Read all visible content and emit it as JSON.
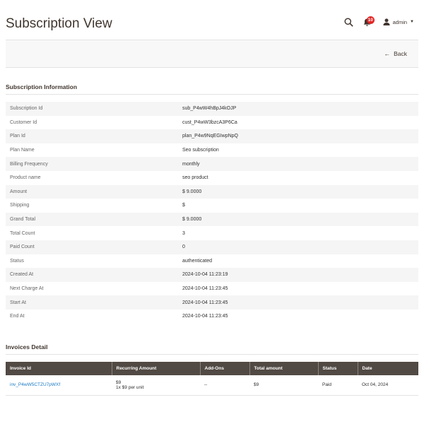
{
  "header": {
    "title": "Subscription View",
    "notification_count": "10",
    "user_name": "admin"
  },
  "actions": {
    "back_label": "Back"
  },
  "subscription_info": {
    "heading": "Subscription Information",
    "rows": [
      {
        "label": "Subscription Id",
        "value": "sub_P4wW4hBpJ4kOJP"
      },
      {
        "label": "Customer Id",
        "value": "cust_P4wW3bzcA3P6Ca"
      },
      {
        "label": "Plan Id",
        "value": "plan_P4w9NqEGIwpNpQ"
      },
      {
        "label": "Plan Name",
        "value": "Seo subscription"
      },
      {
        "label": "Billing Frequency",
        "value": "monthly"
      },
      {
        "label": "Product name",
        "value": "seo product"
      },
      {
        "label": "Amount",
        "value": "$ 9.0000"
      },
      {
        "label": "Shipping",
        "value": "$"
      },
      {
        "label": "Grand Total",
        "value": "$ 9.0000"
      },
      {
        "label": "Total Count",
        "value": "3"
      },
      {
        "label": "Paid Count",
        "value": "0"
      },
      {
        "label": "Status",
        "value": "authenticated"
      },
      {
        "label": "Created At",
        "value": "2024-10-04 11:23:19"
      },
      {
        "label": "Next Charge At",
        "value": "2024-10-04 11:23:45"
      },
      {
        "label": "Start At",
        "value": "2024-10-04 11:23:45"
      },
      {
        "label": "End At",
        "value": "2024-10-04 11:23:45"
      }
    ]
  },
  "invoices": {
    "heading": "Invoices Detail",
    "columns": [
      "Invoice Id",
      "Recurring Amount",
      "Add-Ons",
      "Total amount",
      "Status",
      "Date"
    ],
    "rows": [
      {
        "invoice_id": "inv_P4wW5CTZU7pWXf",
        "recurring_amount": "$9",
        "recurring_detail": "1x $9 per unit",
        "add_ons": "--",
        "total_amount": "$9",
        "status": "Paid",
        "date": "Oct 04, 2024"
      }
    ]
  }
}
